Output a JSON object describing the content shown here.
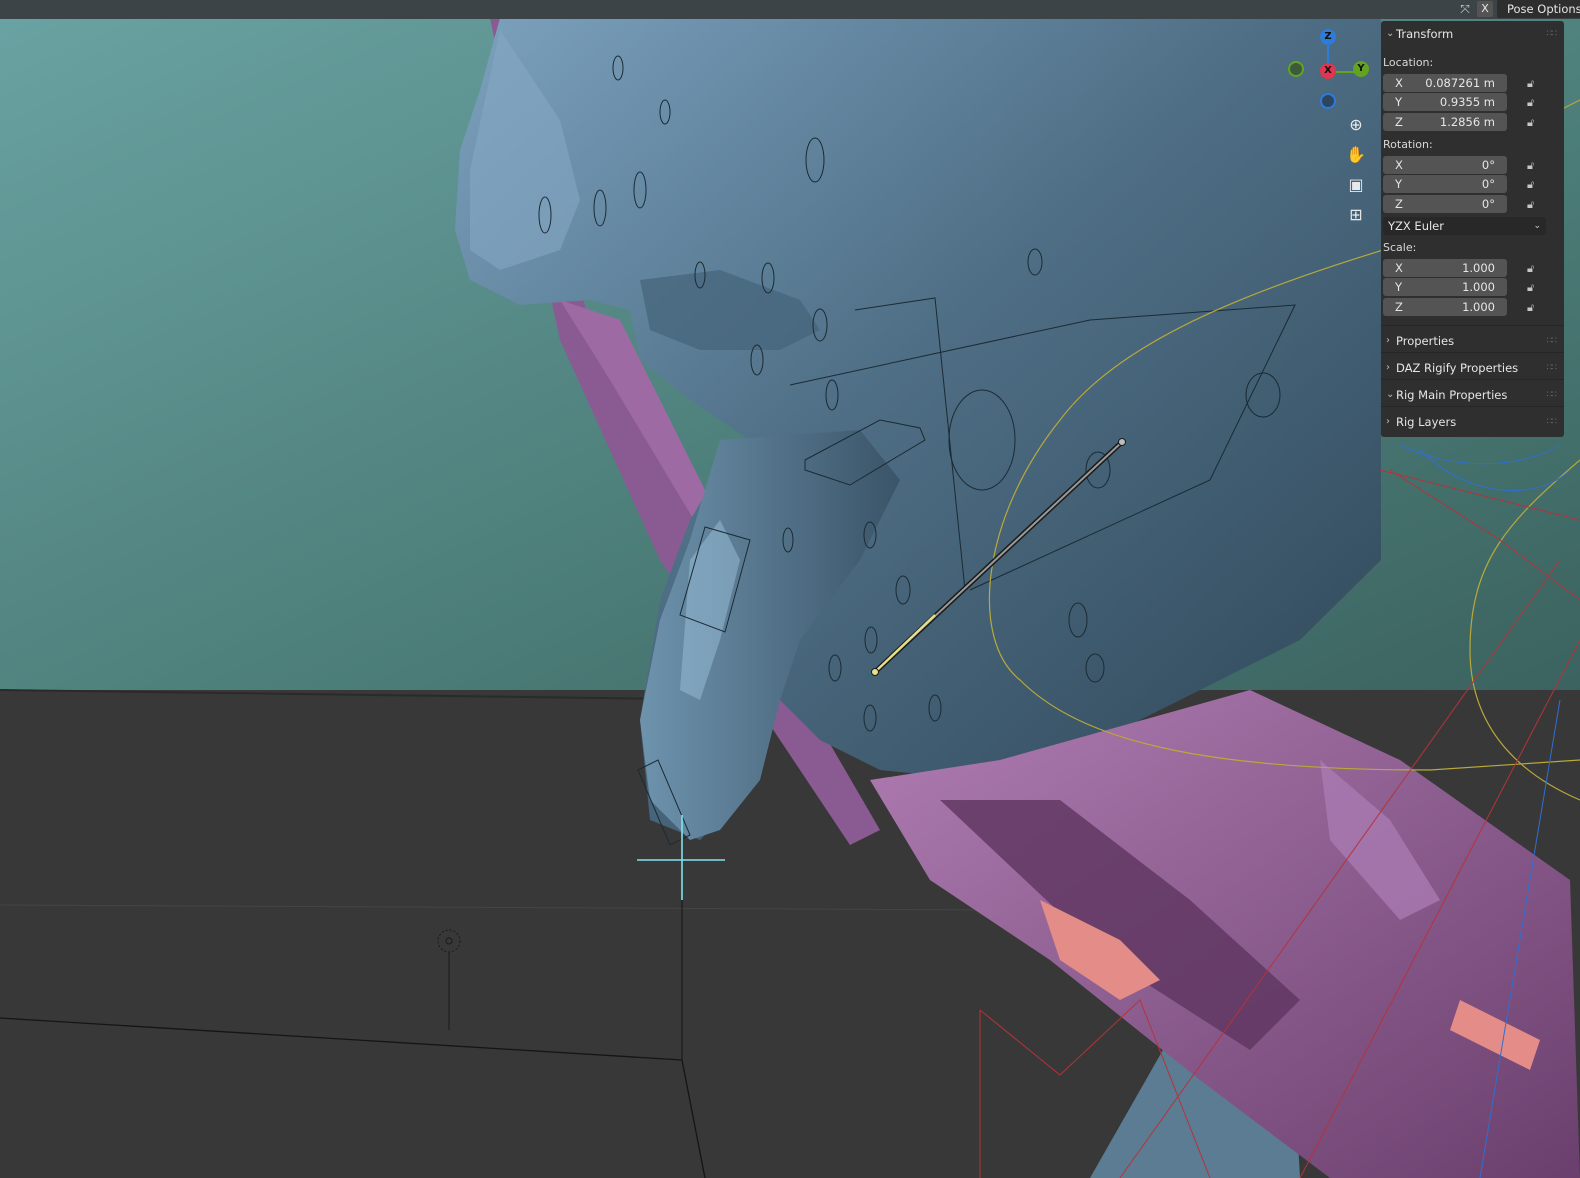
{
  "header": {
    "close_label": "X",
    "pose_options_label": "Pose Options"
  },
  "gizmo": {
    "axes": {
      "z": "Z",
      "x": "X",
      "y": "Y"
    },
    "colors": {
      "z": "#2f7bd9",
      "x": "#e0364f",
      "y": "#62a420"
    }
  },
  "tools": [
    "zoom-icon",
    "hand-pan-icon",
    "camera-icon",
    "perspective-grid-icon"
  ],
  "sidebar": {
    "transform": {
      "title": "Transform",
      "location_label": "Location:",
      "location": [
        {
          "axis": "X",
          "value": "0.087261 m"
        },
        {
          "axis": "Y",
          "value": "0.9355 m"
        },
        {
          "axis": "Z",
          "value": "1.2856 m"
        }
      ],
      "rotation_label": "Rotation:",
      "rotation": [
        {
          "axis": "X",
          "value": "0°"
        },
        {
          "axis": "Y",
          "value": "0°"
        },
        {
          "axis": "Z",
          "value": "0°"
        }
      ],
      "rotation_mode": "YZX Euler",
      "scale_label": "Scale:",
      "scale": [
        {
          "axis": "X",
          "value": "1.000"
        },
        {
          "axis": "Y",
          "value": "1.000"
        },
        {
          "axis": "Z",
          "value": "1.000"
        }
      ]
    },
    "panels": [
      {
        "label": "Properties",
        "expanded": false
      },
      {
        "label": "DAZ Rigify Properties",
        "expanded": false
      },
      {
        "label": "Rig Main Properties",
        "expanded": true
      },
      {
        "label": "Rig Layers",
        "expanded": false
      }
    ]
  }
}
